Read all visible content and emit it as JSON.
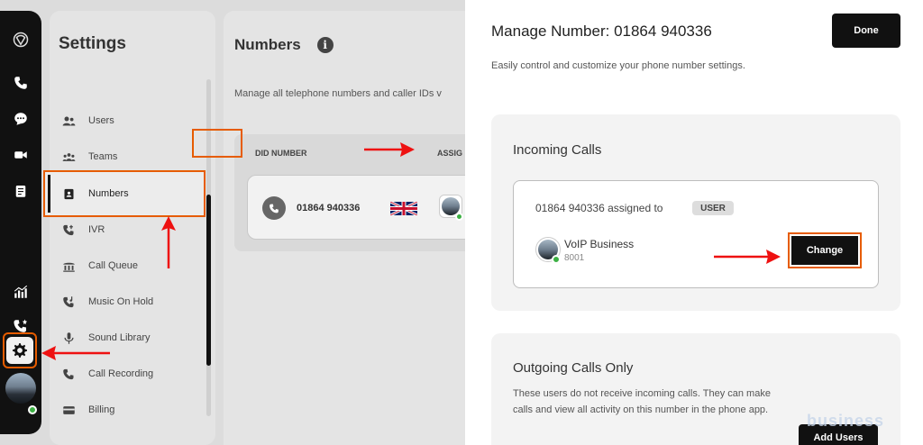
{
  "settings": {
    "title": "Settings",
    "menu": [
      {
        "label": "Users",
        "icon": "users-icon"
      },
      {
        "label": "Teams",
        "icon": "teams-icon"
      },
      {
        "label": "Numbers",
        "icon": "numbers-icon"
      },
      {
        "label": "IVR",
        "icon": "ivr-icon"
      },
      {
        "label": "Call Queue",
        "icon": "call-queue-icon"
      },
      {
        "label": "Music On Hold",
        "icon": "music-on-hold-icon"
      },
      {
        "label": "Sound Library",
        "icon": "microphone-icon"
      },
      {
        "label": "Call Recording",
        "icon": "call-recording-icon"
      },
      {
        "label": "Billing",
        "icon": "billing-icon"
      }
    ],
    "active_item": "Numbers"
  },
  "numbers": {
    "title": "Numbers",
    "description": "Manage all telephone numbers and caller IDs v",
    "columns": [
      "DID NUMBER",
      "ASSIG"
    ],
    "rows": [
      {
        "number": "01864 940336",
        "flag": "uk-flag-icon"
      }
    ]
  },
  "modal": {
    "title": "Manage Number: 01864 940336",
    "subtitle": "Easily control and customize your phone number settings.",
    "done_label": "Done",
    "incoming": {
      "title": "Incoming Calls",
      "assigned_text": "01864 940336 assigned to",
      "badge": "USER",
      "assignee_name": "VoIP Business",
      "assignee_ext": "8001",
      "change_label": "Change"
    },
    "outgoing": {
      "title": "Outgoing Calls Only",
      "description": "These users do not receive incoming calls. They can make calls and view all activity on this number in the phone app.",
      "add_label": "Add Users"
    }
  },
  "watermark": "business",
  "colors": {
    "highlight": "#e65c00",
    "arrow": "#ee1111",
    "rail": "#111111",
    "online": "#3cb043"
  }
}
